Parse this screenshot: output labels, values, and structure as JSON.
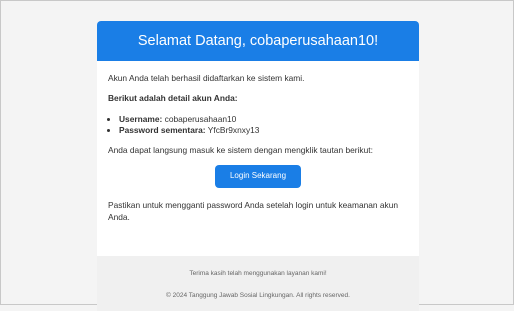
{
  "email": {
    "header_title": "Selamat Datang, cobaperusahaan10!",
    "intro": "Akun Anda telah berhasil didaftarkan ke sistem kami.",
    "details_heading": "Berikut adalah detail akun Anda:",
    "details": [
      {
        "label": "Username:",
        "value": "cobaperusahaan10"
      },
      {
        "label": "Password sementara:",
        "value": "YfcBr9xnxy13"
      }
    ],
    "direct_login_text": "Anda dapat langsung masuk ke sistem dengan mengklik tautan berikut:",
    "login_button_label": "Login Sekarang",
    "reminder": "Pastikan untuk mengganti password Anda setelah login untuk keamanan akun Anda.",
    "footer": {
      "thanks": "Terima kasih telah menggunakan layanan kami!",
      "copyright": "© 2024 Tanggung Jawab Sosial Lingkungan. All rights reserved."
    },
    "colors": {
      "accent": "#1a7ee6",
      "page_background": "#f4f4f4",
      "footer_background": "#f0f0f0"
    }
  }
}
